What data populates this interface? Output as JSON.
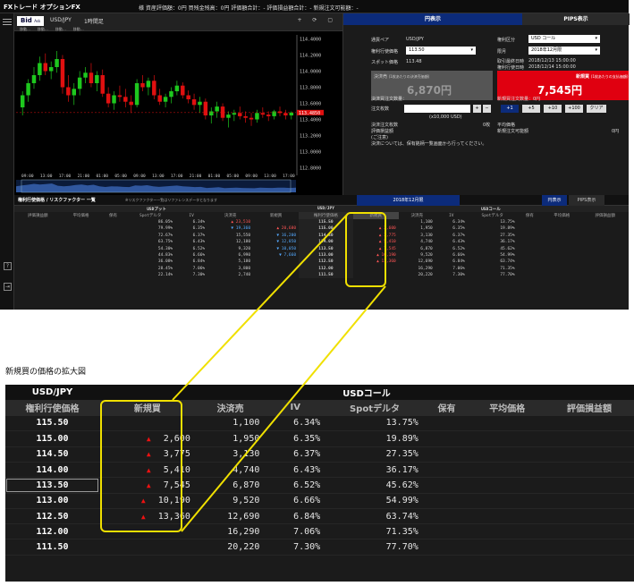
{
  "app": {
    "logo": "FXトレード オプションFX",
    "account_summary": "様  資産評価額：0円  買残金残高：0円  評価額合計：-  評価損益額合計：-  新規注文可能額：-"
  },
  "sidebar": {
    "help_icon": "?",
    "logout_icon": "⇥"
  },
  "chart": {
    "bid_tab": "Bid",
    "bid_sub": "Ask",
    "symbol": "USD/JPY",
    "period": "1時間足",
    "indicators": [
      "移動…",
      "移動…",
      "移動…",
      "移動…"
    ],
    "y_ticks": [
      "114.4000",
      "114.2000",
      "114.0000",
      "113.8000",
      "113.6000",
      "113.4000",
      "113.2000",
      "113.0000",
      "112.8000"
    ],
    "current_price": "113.4850",
    "x_ticks": [
      "09:00",
      "13:00",
      "17:00",
      "21:00",
      "01:00",
      "05:00",
      "09:00",
      "13:00",
      "17:00",
      "21:00",
      "01:00",
      "05:00",
      "09:00",
      "13:00",
      "17:00"
    ],
    "hdr_icons": "+ ⟳ ▢"
  },
  "chart_data": {
    "type": "candlestick",
    "symbol": "USD/JPY",
    "y_range": [
      112.75,
      114.45
    ],
    "candles": [
      [
        113.55,
        113.75,
        113.45,
        113.7
      ],
      [
        113.7,
        113.9,
        113.62,
        113.85
      ],
      [
        113.85,
        114.05,
        113.78,
        113.95
      ],
      [
        113.95,
        114.18,
        113.88,
        114.1
      ],
      [
        114.1,
        114.22,
        113.95,
        114.0
      ],
      [
        114.0,
        114.12,
        113.9,
        114.05
      ],
      [
        114.05,
        114.25,
        113.98,
        114.15
      ],
      [
        114.15,
        114.2,
        113.72,
        113.8
      ],
      [
        113.8,
        113.95,
        113.62,
        113.7
      ],
      [
        113.7,
        113.85,
        113.58,
        113.78
      ],
      [
        113.78,
        114.0,
        113.7,
        113.92
      ],
      [
        113.92,
        114.05,
        113.85,
        113.98
      ],
      [
        113.98,
        114.1,
        113.8,
        113.85
      ],
      [
        113.85,
        114.0,
        113.75,
        113.95
      ],
      [
        113.95,
        114.02,
        113.68,
        113.72
      ],
      [
        113.72,
        113.8,
        113.55,
        113.6
      ],
      [
        113.6,
        113.75,
        113.52,
        113.7
      ],
      [
        113.7,
        113.82,
        113.62,
        113.68
      ],
      [
        113.68,
        113.78,
        113.55,
        113.62
      ],
      [
        113.62,
        113.7,
        113.48,
        113.58
      ],
      [
        113.58,
        113.9,
        113.55,
        113.85
      ],
      [
        113.85,
        113.95,
        113.75,
        113.8
      ],
      [
        113.8,
        113.92,
        113.7,
        113.88
      ],
      [
        113.88,
        113.95,
        113.65,
        113.7
      ],
      [
        113.7,
        113.78,
        113.58,
        113.62
      ],
      [
        113.62,
        113.72,
        113.55,
        113.68
      ],
      [
        113.68,
        113.8,
        113.6,
        113.75
      ],
      [
        113.75,
        113.88,
        113.7,
        113.82
      ],
      [
        113.82,
        113.86,
        113.66,
        113.7
      ],
      [
        113.7,
        113.76,
        113.6,
        113.65
      ],
      [
        113.65,
        113.72,
        113.52,
        113.58
      ],
      [
        113.58,
        113.68,
        113.48,
        113.62
      ],
      [
        113.62,
        113.66,
        113.4,
        113.45
      ],
      [
        113.45,
        113.55,
        113.35,
        113.5
      ],
      [
        113.5,
        113.62,
        113.42,
        113.56
      ],
      [
        113.56,
        113.6,
        113.38,
        113.42
      ],
      [
        113.42,
        113.5,
        113.3,
        113.46
      ],
      [
        113.46,
        113.52,
        113.38,
        113.48
      ],
      [
        113.48,
        113.56,
        113.4,
        113.44
      ],
      [
        113.44,
        113.5,
        113.36,
        113.42
      ],
      [
        113.42,
        113.48,
        113.32,
        113.4
      ],
      [
        113.4,
        113.52,
        113.36,
        113.48
      ],
      [
        113.48,
        113.55,
        113.42,
        113.46
      ],
      [
        113.46,
        113.5,
        113.38,
        113.44
      ],
      [
        113.44,
        113.52,
        113.4,
        113.5
      ],
      [
        113.5,
        113.56,
        113.44,
        113.48
      ],
      [
        113.48,
        113.52,
        113.4,
        113.45
      ],
      [
        113.45,
        113.5,
        113.4,
        113.485
      ]
    ]
  },
  "order_panel": {
    "tab_left": "円表示",
    "tab_right": "PIPS表示",
    "currency_pair_label": "通貨ペア",
    "currency_pair": "USD/JPY",
    "strike_label": "権利行使価格",
    "strike_value": "113.50",
    "spot_label": "スポット価格",
    "spot_value": "113.48",
    "option_type_label": "権利区分",
    "option_type": "USD コール",
    "month_label": "限月",
    "month": "2018年12月限",
    "last_trade_label": "取引最終日時",
    "last_trade": "2018/12/13 15:00:00",
    "exercise_label": "権利行使日時",
    "exercise": "2018/12/14 15:00:00",
    "sell_title": "決済売",
    "sell_sub": "(1枚あたりの決済売価額)",
    "sell_price": "6,870円",
    "buy_title": "新規買",
    "buy_sub": "(1枚あたりの支払価額)",
    "buy_price": "7,545円",
    "settle_qty_label": "決済買注文数量：",
    "new_qty_label": "新規買注文数量：0円",
    "lots_label": "注文枚数",
    "unit_label": "(x10,000 USD)",
    "pm_plus": "+",
    "pm_minus": "−",
    "buttons": [
      "+1",
      "+5",
      "+10",
      "+100",
      "クリア"
    ],
    "settle_orders_label": "決済注文枚数",
    "settle_orders_value": "0枚",
    "avg_price_label": "平均価格",
    "pl_label": "評価損益額",
    "pl_note": "(ご注意)",
    "new_orders_possible_label": "新規注文可能額",
    "new_orders_possible_value": "0円",
    "notice": "決済については、保有銘柄一覧画面から行ってください。"
  },
  "lower_small": {
    "title": "権利行使価格 / リスクファクター 一覧",
    "subtitle": "※リスクファクター一覧はリファレンスデータとなります",
    "month_center": "2018年12月限",
    "tab_left": "円表示",
    "tab_right": "PIPS表示",
    "usd_put": "USDプット",
    "usd_jpy": "USD/JPY",
    "usd_call": "USDコール",
    "headers": [
      "評価損益額",
      "平均価格",
      "保有",
      "Spotデルタ",
      "IV",
      "決済売",
      "新規買",
      "権利行使価格",
      "新規買",
      "決済売",
      "IV",
      "Spotデルタ",
      "保有",
      "平均価格",
      "評価損益額"
    ],
    "rows": [
      [
        "",
        "",
        "",
        "86.05%",
        "6.34%",
        "▲ 23,510",
        "",
        "115.50",
        "",
        "1,100",
        "6.34%",
        "13.75%",
        "",
        "",
        ""
      ],
      [
        "",
        "",
        "",
        "79.99%",
        "6.35%",
        "▼ 19,360",
        "▲ 20,680",
        "115.00",
        "▲ 2,600",
        "1,950",
        "6.35%",
        "19.89%",
        "",
        "",
        ""
      ],
      [
        "",
        "",
        "",
        "72.67%",
        "6.37%",
        "15,550",
        "▼ 16,200",
        "114.50",
        "▲ 3,775",
        "3,130",
        "6.37%",
        "27.35%",
        "",
        "",
        ""
      ],
      [
        "",
        "",
        "",
        "63.75%",
        "6.43%",
        "12,180",
        "▼ 12,850",
        "114.00",
        "▲ 5,410",
        "4,740",
        "6.43%",
        "36.17%",
        "",
        "",
        ""
      ],
      [
        "",
        "",
        "",
        "54.30%",
        "6.52%",
        "9,320",
        "▼ 10,050",
        "113.50",
        "▲ 7,545",
        "6,870",
        "6.52%",
        "45.62%",
        "",
        "",
        ""
      ],
      [
        "",
        "",
        "",
        "44.83%",
        "6.66%",
        "6,990",
        "▼ 7,660",
        "113.00",
        "▲ 10,190",
        "9,520",
        "6.66%",
        "54.99%",
        "",
        "",
        ""
      ],
      [
        "",
        "",
        "",
        "36.08%",
        "6.84%",
        "5,180",
        "",
        "112.50",
        "▲ 13,360",
        "12,690",
        "6.84%",
        "63.74%",
        "",
        "",
        ""
      ],
      [
        "",
        "",
        "",
        "28.45%",
        "7.06%",
        "3,800",
        "",
        "112.00",
        "",
        "16,290",
        "7.06%",
        "71.35%",
        "",
        "",
        ""
      ],
      [
        "",
        "",
        "",
        "22.14%",
        "7.30%",
        "2,740",
        "",
        "111.50",
        "",
        "20,220",
        "7.30%",
        "77.70%",
        "",
        "",
        ""
      ]
    ]
  },
  "caption": "新規買の価格の拡大図",
  "zoom": {
    "usd_jpy": "USD/JPY",
    "usd_call": "USDコール",
    "headers": [
      "権利行使価格",
      "新規買",
      "決済売",
      "IV",
      "Spotデルタ",
      "保有",
      "平均価格",
      "評価損益額"
    ],
    "rows": [
      {
        "strike": "115.50",
        "new_buy": "",
        "settle": "1,100",
        "iv": "6.34%",
        "delta": "13.75%"
      },
      {
        "strike": "115.00",
        "new_buy": "2,600",
        "settle": "1,950",
        "iv": "6.35%",
        "delta": "19.89%"
      },
      {
        "strike": "114.50",
        "new_buy": "3,775",
        "settle": "3,130",
        "iv": "6.37%",
        "delta": "27.35%"
      },
      {
        "strike": "114.00",
        "new_buy": "5,410",
        "settle": "4,740",
        "iv": "6.43%",
        "delta": "36.17%"
      },
      {
        "strike": "113.50",
        "new_buy": "7,545",
        "settle": "6,870",
        "iv": "6.52%",
        "delta": "45.62%"
      },
      {
        "strike": "113.00",
        "new_buy": "10,190",
        "settle": "9,520",
        "iv": "6.66%",
        "delta": "54.99%"
      },
      {
        "strike": "112.50",
        "new_buy": "13,360",
        "settle": "12,690",
        "iv": "6.84%",
        "delta": "63.74%"
      },
      {
        "strike": "112.00",
        "new_buy": "",
        "settle": "16,290",
        "iv": "7.06%",
        "delta": "71.35%"
      },
      {
        "strike": "111.50",
        "new_buy": "",
        "settle": "20,220",
        "iv": "7.30%",
        "delta": "77.70%"
      }
    ]
  },
  "colors": {
    "highlight": "#f0e000",
    "buy_red": "#e00010",
    "up_green": "#1ec81e",
    "down_red": "#e01010",
    "panel_dark": "#1b1b1b"
  }
}
